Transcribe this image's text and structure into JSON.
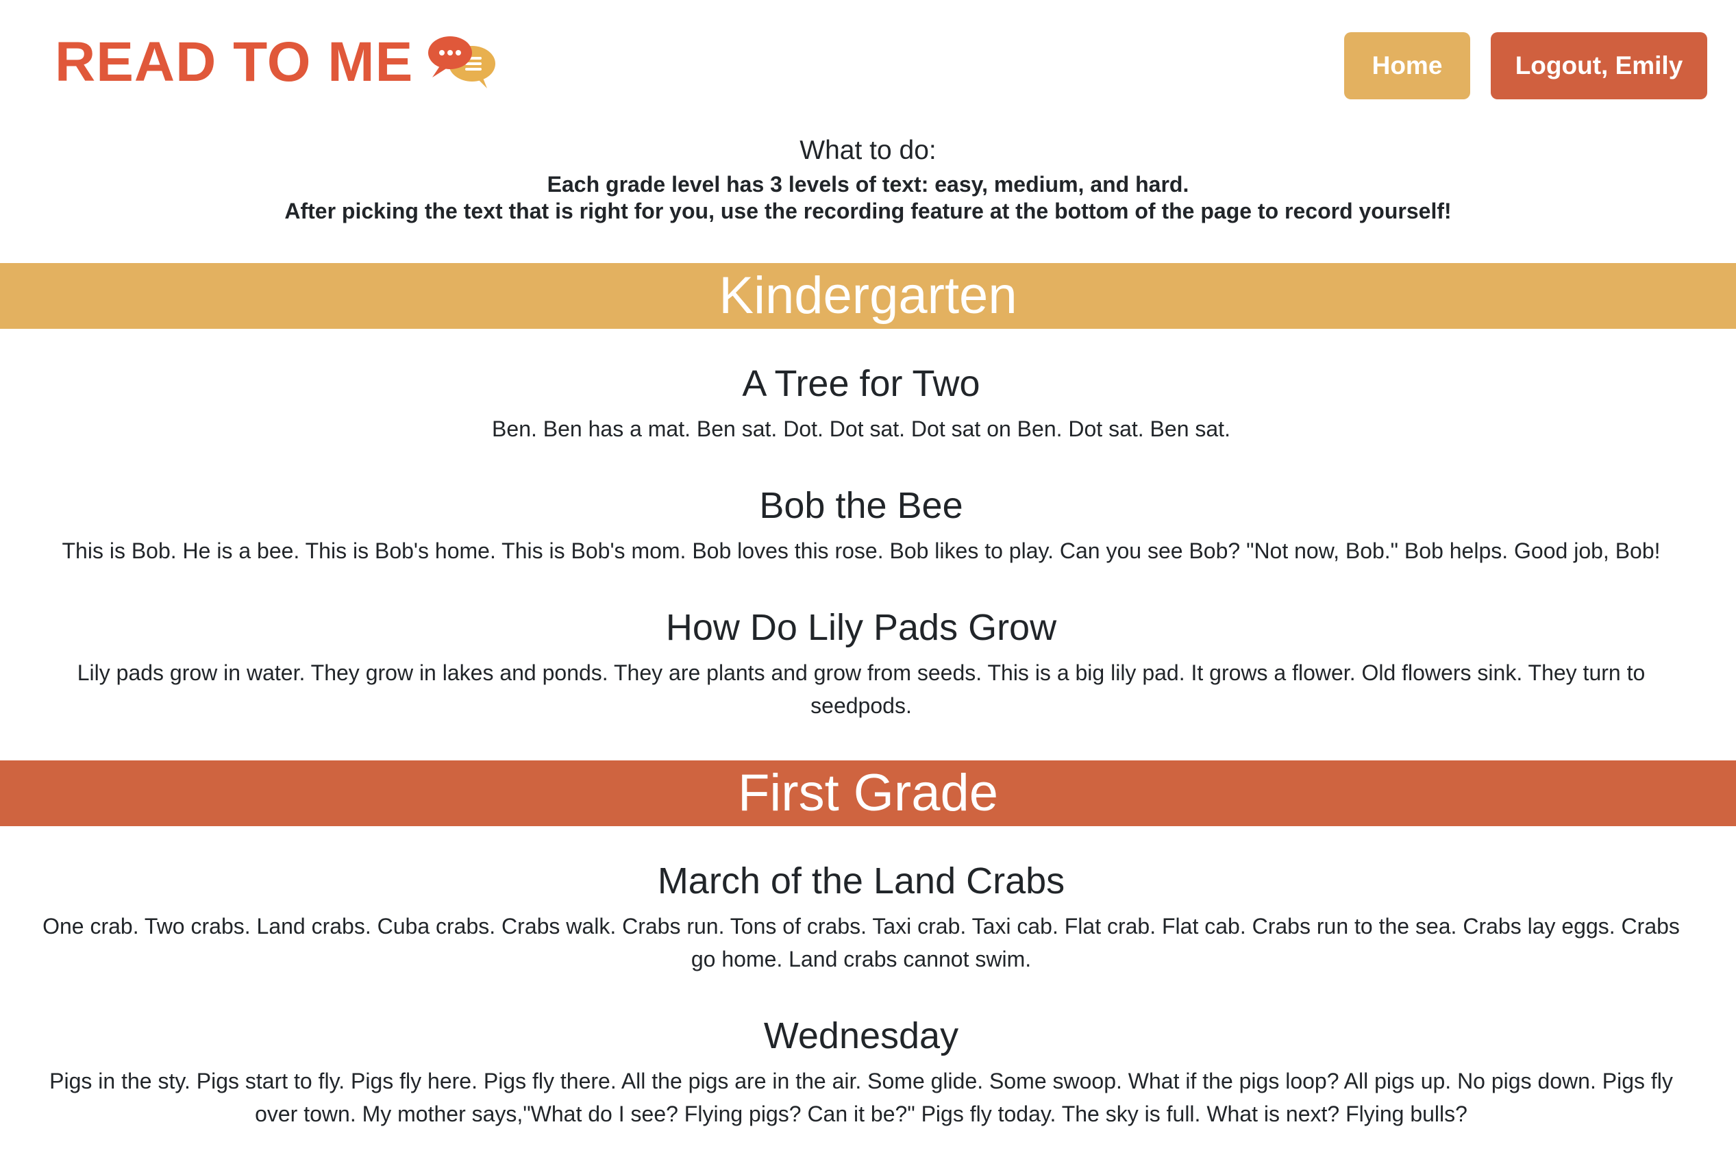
{
  "header": {
    "logo_text": "READ TO ME",
    "logo_icon": "speech-bubbles-icon",
    "home_label": "Home",
    "logout_label": "Logout, Emily"
  },
  "colors": {
    "brand": "#e0583a",
    "home_button": "#e3b160",
    "logout_button": "#d0603f",
    "kindergarten_banner": "#e3b160",
    "first_grade_banner": "#cf6440"
  },
  "instructions": {
    "title": "What to do:",
    "line1": "Each grade level has 3 levels of text: easy, medium, and hard.",
    "line2": "After picking the text that is right for you, use the recording feature at the bottom of the page to record yourself!"
  },
  "grades": [
    {
      "name": "Kindergarten",
      "stories": [
        {
          "title": "A Tree for Two",
          "text": "Ben. Ben has a mat. Ben sat. Dot. Dot sat. Dot sat on Ben. Dot sat. Ben sat."
        },
        {
          "title": "Bob the Bee",
          "text": "This is Bob. He is a bee. This is Bob's home. This is Bob's mom. Bob loves this rose. Bob likes to play. Can you see Bob? \"Not now, Bob.\" Bob helps. Good job, Bob!"
        },
        {
          "title": "How Do Lily Pads Grow",
          "text": "Lily pads grow in water. They grow in lakes and ponds. They are plants and grow from seeds. This is a big lily pad. It grows a flower. Old flowers sink. They turn to seedpods."
        }
      ]
    },
    {
      "name": "First Grade",
      "stories": [
        {
          "title": "March of the Land Crabs",
          "text": "One crab. Two crabs. Land crabs. Cuba crabs. Crabs walk. Crabs run. Tons of crabs. Taxi crab. Taxi cab. Flat crab. Flat cab. Crabs run to the sea. Crabs lay eggs. Crabs go home. Land crabs cannot swim."
        },
        {
          "title": "Wednesday",
          "text": "Pigs in the sty. Pigs start to fly. Pigs fly here. Pigs fly there. All the pigs are in the air. Some glide. Some swoop. What if the pigs loop? All pigs up. No pigs down. Pigs fly over town. My mother says,\"What do I see? Flying pigs? Can it be?\" Pigs fly today. The sky is full. What is next? Flying bulls?"
        }
      ]
    }
  ]
}
